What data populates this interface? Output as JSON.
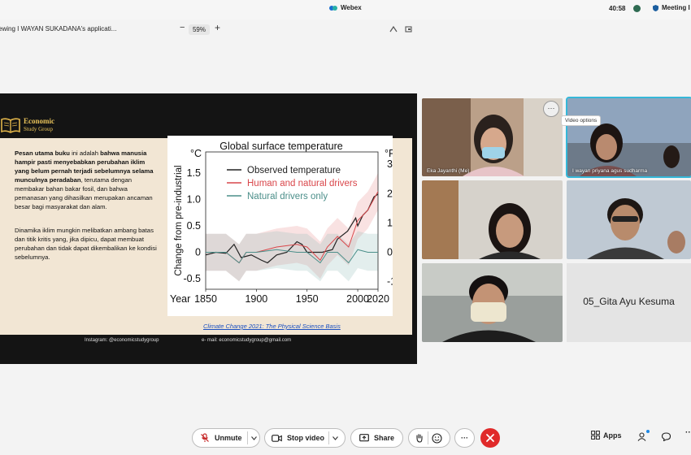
{
  "app": {
    "title": "Webex",
    "clock": "40:58",
    "meeting_label": "Meeting I"
  },
  "share": {
    "title": "ewing I WAYAN SUKADANA's applicati...",
    "zoom_out": "−",
    "zoom_level": "59%",
    "zoom_in": "+"
  },
  "slide": {
    "logo_line1": "Economic",
    "logo_line2": "Study Group",
    "para1_bold1": "Pesan utama buku",
    "para1_text1": " ini adalah ",
    "para1_bold2": "bahwa manusia hampir pasti menyebabkan perubahan iklim yang belum pernah terjadi sebelumnya selama munculnya peradaban",
    "para1_text2": ", terutama dengan membakar bahan bakar fosil, dan bahwa pemanasan yang dihasilkan merupakan ancaman besar bagi masyarakat dan alam.",
    "para2": "Dinamika iklim mungkin melibatkan ambang batas dan titik kritis yang, jika dipicu, dapat membuat perubahan dan tidak dapat dikembalikan ke kondisi sebelumnya.",
    "citation": "Climate Change 2021: The Physical Science Basis",
    "instagram": "Instagram: @economicstudygroup",
    "email": "e- mail: economicstudygroup@gmail.com"
  },
  "chart_data": {
    "type": "line",
    "title": "Global surface temperature",
    "ylabel": "Change from pre-industrial",
    "y_unit_left": "°C",
    "y_unit_right": "°F",
    "xlabel": "Year",
    "xlim": [
      1850,
      2020
    ],
    "ylim": [
      -0.7,
      1.9
    ],
    "x_ticks": [
      "1850",
      "1900",
      "1950",
      "2000",
      "2020"
    ],
    "y_ticks_left": [
      "1.5",
      "1.0",
      "0.5",
      "0",
      "-0.5"
    ],
    "y_ticks_right": [
      "3.0",
      "2.0",
      "1.0",
      "0",
      "-1.0"
    ],
    "legend_position": "top-left",
    "series": [
      {
        "name": "Observed temperature",
        "color": "#222222",
        "x": [
          1850,
          1860,
          1870,
          1878,
          1885,
          1895,
          1905,
          1911,
          1920,
          1930,
          1940,
          1945,
          1950,
          1955,
          1965,
          1975,
          1980,
          1990,
          1998,
          2000,
          2005,
          2010,
          2016,
          2020
        ],
        "values": [
          -0.05,
          0.0,
          -0.02,
          0.15,
          -0.1,
          -0.05,
          -0.15,
          -0.2,
          -0.05,
          0.0,
          0.2,
          0.15,
          0.0,
          0.0,
          0.0,
          0.05,
          0.25,
          0.4,
          0.65,
          0.5,
          0.7,
          0.8,
          1.05,
          1.1
        ]
      },
      {
        "name": "Human and natural drivers",
        "color": "#d9474b",
        "x": [
          1850,
          1870,
          1883,
          1890,
          1900,
          1920,
          1940,
          1950,
          1963,
          1970,
          1980,
          1991,
          2000,
          2010,
          2020
        ],
        "values": [
          0.0,
          0.0,
          -0.2,
          0.0,
          0.0,
          0.1,
          0.15,
          0.1,
          -0.15,
          0.1,
          0.3,
          0.1,
          0.6,
          0.8,
          1.15
        ]
      },
      {
        "name": "Natural drivers only",
        "color": "#4c8f8a",
        "x": [
          1850,
          1870,
          1883,
          1890,
          1900,
          1920,
          1940,
          1950,
          1963,
          1970,
          1980,
          1991,
          2000,
          2010,
          2020
        ],
        "values": [
          0.0,
          0.0,
          -0.2,
          0.0,
          0.0,
          0.05,
          0.0,
          0.0,
          -0.2,
          0.0,
          0.0,
          -0.2,
          0.05,
          0.0,
          0.0
        ]
      }
    ]
  },
  "participants": [
    {
      "name": "Eka Jayanthi  (Me)"
    },
    {
      "name": "I wayan priyana agus sudharma"
    },
    {
      "name": ""
    },
    {
      "name": ""
    },
    {
      "name": ""
    },
    {
      "name": "05_Gita Ayu Kesuma"
    }
  ],
  "tooltip": "Video options",
  "more_options": "···",
  "controls": {
    "unmute": "Unmute",
    "stop_video": "Stop video",
    "share": "Share",
    "more": "···",
    "apps": "Apps"
  },
  "colors": {
    "end_call": "#e02a2a",
    "active_speaker": "#35b7d8",
    "slide_bg": "#f2e6d4"
  }
}
